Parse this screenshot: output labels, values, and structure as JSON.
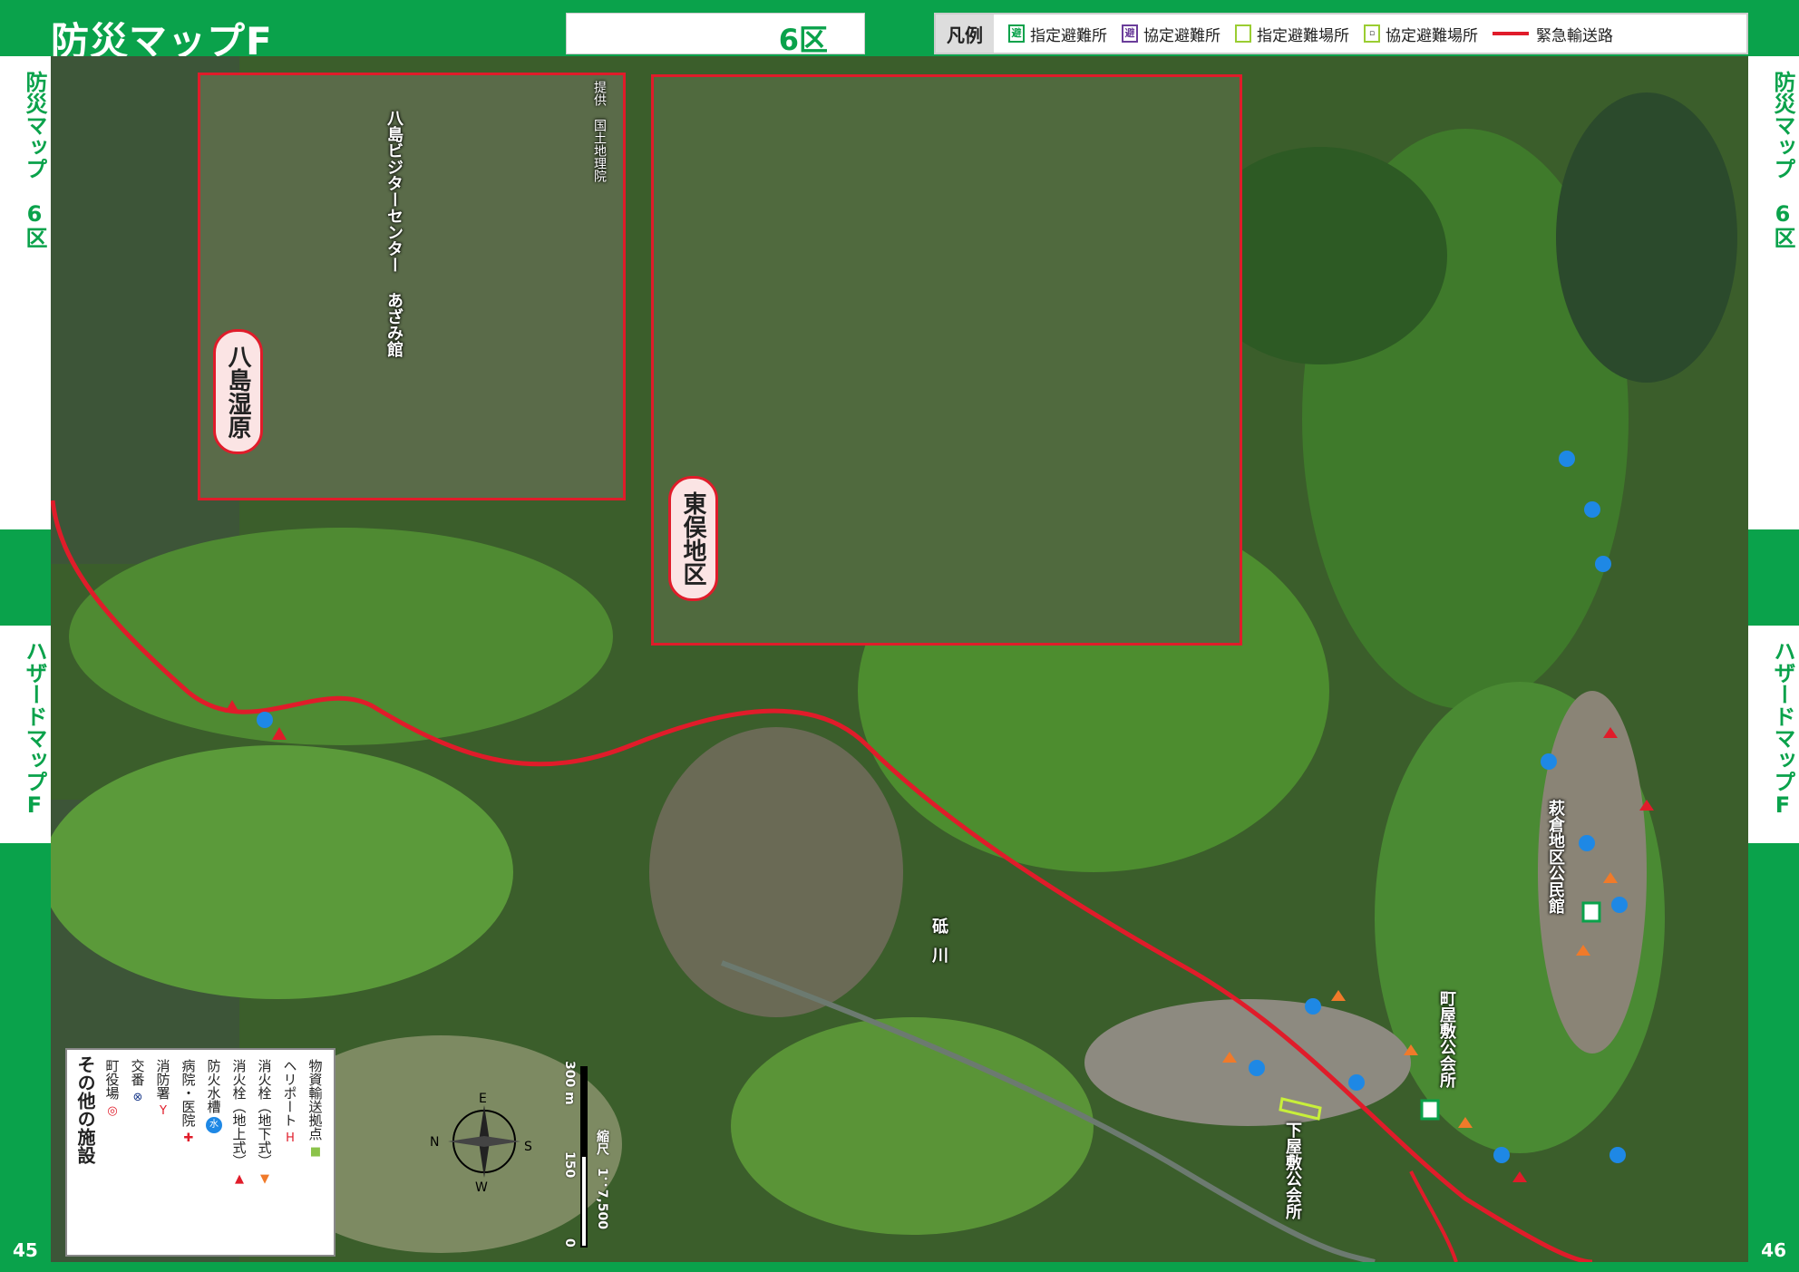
{
  "header": {
    "title": "防災マップF",
    "district": "6区"
  },
  "legend": {
    "title": "凡例",
    "items": [
      {
        "label": "指定避難所",
        "color": "#0aa24b",
        "icon": "designated-shelter-icon"
      },
      {
        "label": "協定避難所",
        "color": "#6a3d9a",
        "icon": "agreement-shelter-icon"
      },
      {
        "label": "指定避難場所",
        "color": "#9acd32",
        "icon": "designated-evac-site-icon"
      },
      {
        "label": "協定避難場所",
        "color": "#9acd32",
        "icon": "agreement-evac-site-icon"
      },
      {
        "label": "緊急輸送路",
        "color": "#e01c2a",
        "icon": "emergency-route-line"
      }
    ]
  },
  "side_tabs": {
    "left_top": "防災マップ　6区",
    "left_bottom": "ハザードマップF",
    "right_top": "防災マップ　6区",
    "right_bottom": "ハザードマップF"
  },
  "page_numbers": {
    "left": "45",
    "right": "46"
  },
  "insets": {
    "yashima": {
      "pill": "八島湿原",
      "facility": "八島ビジターセンター あざみ館",
      "credit": "提供　国土地理院"
    },
    "higashimata": {
      "pill": "東俣地区"
    }
  },
  "map_labels": {
    "river": "砥川",
    "shimoya": "下屋敷公会所",
    "machiya": "町屋敷公会所",
    "hagikura": "萩倉地区公民館"
  },
  "facilities": {
    "title": "その他の施設",
    "items": [
      {
        "label": "町役場",
        "icon": "town-hall-icon",
        "glyph": "◎",
        "color": "#e01c2a"
      },
      {
        "label": "交番",
        "icon": "police-box-icon",
        "glyph": "⊗",
        "color": "#1a3a8a"
      },
      {
        "label": "消防署",
        "icon": "fire-station-icon",
        "glyph": "Y",
        "color": "#e01c2a"
      },
      {
        "label": "病院・医院",
        "icon": "hospital-icon",
        "glyph": "+",
        "color": "#e01c2a"
      },
      {
        "label": "防火水槽",
        "icon": "water-tank-icon",
        "glyph": "水",
        "color": "#1e88e5"
      },
      {
        "label": "消火栓（地上式）",
        "icon": "hydrant-above-icon",
        "glyph": "▲",
        "color": "#e01c2a"
      },
      {
        "label": "消火栓（地下式）",
        "icon": "hydrant-below-icon",
        "glyph": "▼",
        "color": "#f07a2a"
      },
      {
        "label": "ヘリポート",
        "icon": "heliport-icon",
        "glyph": "H",
        "color": "#e01c2a"
      },
      {
        "label": "物資輸送拠点",
        "icon": "supply-base-icon",
        "glyph": "■",
        "color": "#8bc34a"
      }
    ]
  },
  "scale": {
    "ratio": "縮尺　1：7,500",
    "t0": "0",
    "t150": "150",
    "t300": "300 m"
  },
  "compass": {
    "n": "N",
    "s": "S",
    "e": "E",
    "w": "W"
  }
}
